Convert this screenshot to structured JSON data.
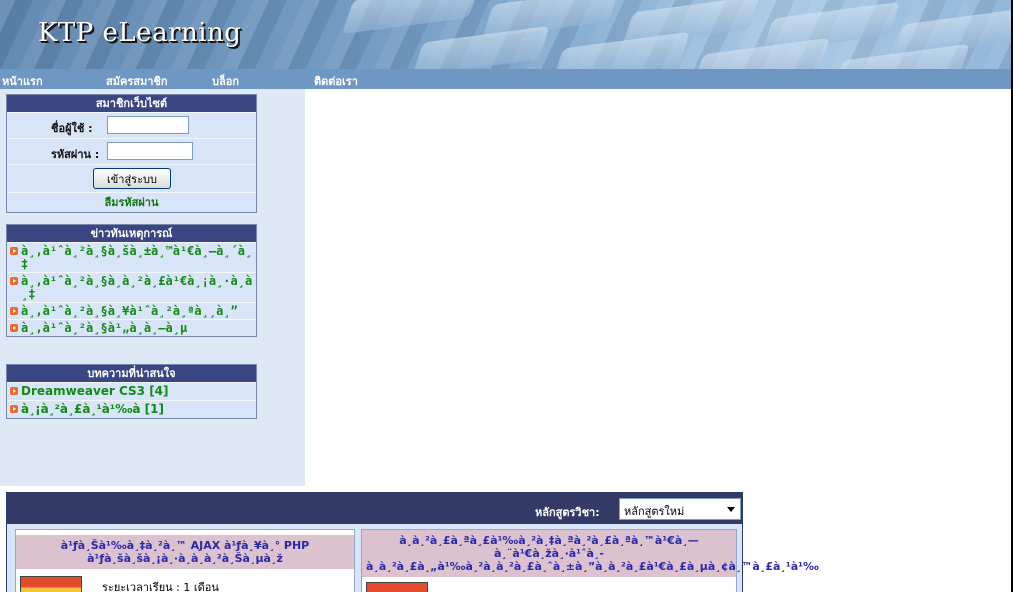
{
  "header": {
    "site_title": "KTP eLearning"
  },
  "nav": {
    "items": [
      "หน้าแรก",
      "สมัครสมาชิก",
      "บล็อก",
      "ติดต่อเรา"
    ]
  },
  "member_box": {
    "title": "สมาชิกเว็บไซต์",
    "username_label": "ชื่อผู้ใช้ :",
    "username_value": "",
    "password_label": "รหัสผ่าน :",
    "password_value": "",
    "login_button": "เข้าสู่ระบบ",
    "forgot_link": "ลืมรหัสผ่าน"
  },
  "news_box": {
    "title": "ข่าวทันเหตุการณ์",
    "items": [
      "à¸‚à¹ˆà¸²à¸§à¸šà¸±à¸™à¹€à¸—à¸´à¸‡",
      "à¸‚à¹ˆà¸²à¸§à¸à¸²à¸£à¹€à¸¡à¸·à¸­à¸‡",
      "à¸‚à¹ˆà¸²à¸§à¸¥à¹ˆà¸²à¸ªà¸¸à¸”",
      "à¸‚à¹ˆà¸²à¸§à¹„à¸­à¸—à¸µ"
    ]
  },
  "article_box": {
    "title": "บทความที่น่าสนใจ",
    "items": [
      "Dreamweaver CS3 [4]",
      "à¸¡à¸²à¸£à¸¹à¹‰à [1]"
    ]
  },
  "course_section": {
    "label": "หลักสูตรวิชา:",
    "selected": "หลักสูตรใหม่",
    "cards": [
      {
        "title": "à¹ƒà¸Šà¹‰à¸‡à¸²à¸™ AJAX à¹ƒà¸¥à¸° PHP à¹ƒà¸šà¸šà¸¡à¸·à¸­à¸­à¸²à¸Šà¸µà¸ž",
        "duration": "ระยะเวลาเรียน : 1 เดือน"
      },
      {
        "title": "à¸à¸²à¸£à¸ªà¸£à¹‰à¸²à¸‡à¸ªà¸²à¸£à¸ªà¸™à¹€à¸—à¸¨à¹€à¸žà¸·à¹ˆà¸­à¸à¸²à¸£à¸„à¹‰à¸²à¸à¸²à¸£à¸ˆà¸±à¸”à¸à¸²à¸£à¹€à¸£à¸µà¸¢à¸™à¸£à¸¹à¹‰"
      }
    ]
  }
}
